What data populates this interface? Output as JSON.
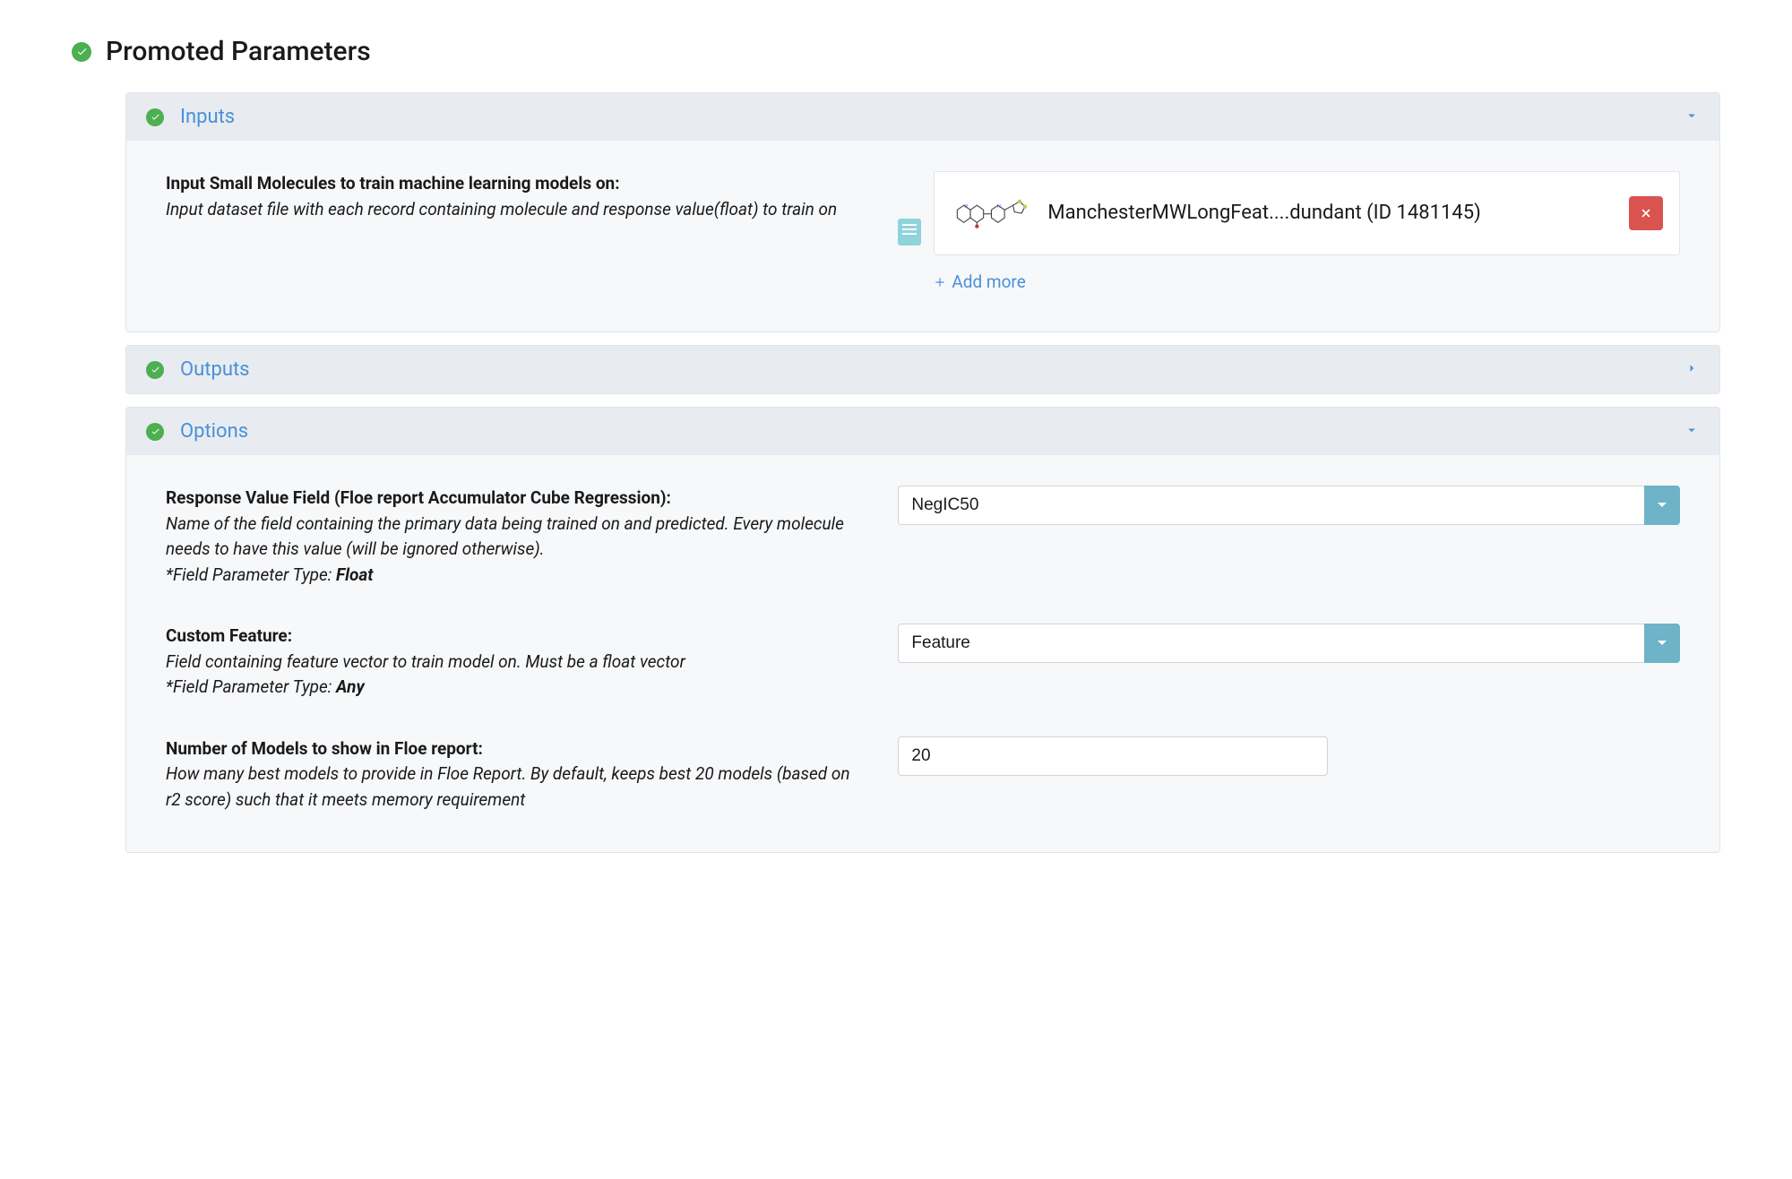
{
  "section_title": "Promoted Parameters",
  "panels": {
    "inputs": {
      "title": "Inputs",
      "field": {
        "label": "Input Small Molecules to train machine learning models on:",
        "desc": "Input dataset file with each record containing molecule and response value(float) to train on",
        "file_name": "ManchesterMWLongFeat....dundant (ID 1481145)",
        "add_more": "Add more"
      }
    },
    "outputs": {
      "title": "Outputs"
    },
    "options": {
      "title": "Options",
      "response_field": {
        "label": "Response Value Field (Floe report Accumulator Cube Regression):",
        "desc": "Name of the field containing the primary data being trained on and predicted. Every molecule needs to have this value (will be ignored otherwise).",
        "param_type_prefix": "*Field Parameter Type: ",
        "param_type": "Float",
        "value": "NegIC50"
      },
      "custom_feature": {
        "label": "Custom Feature:",
        "desc": "Field containing feature vector to train model on. Must be a float vector",
        "param_type_prefix": "*Field Parameter Type: ",
        "param_type": "Any",
        "value": "Feature"
      },
      "num_models": {
        "label": "Number of Models to show in Floe report:",
        "desc": "How many best models to provide in Floe Report. By default, keeps best 20 models (based on r2 score) such that it meets memory requirement",
        "value": "20"
      }
    }
  }
}
